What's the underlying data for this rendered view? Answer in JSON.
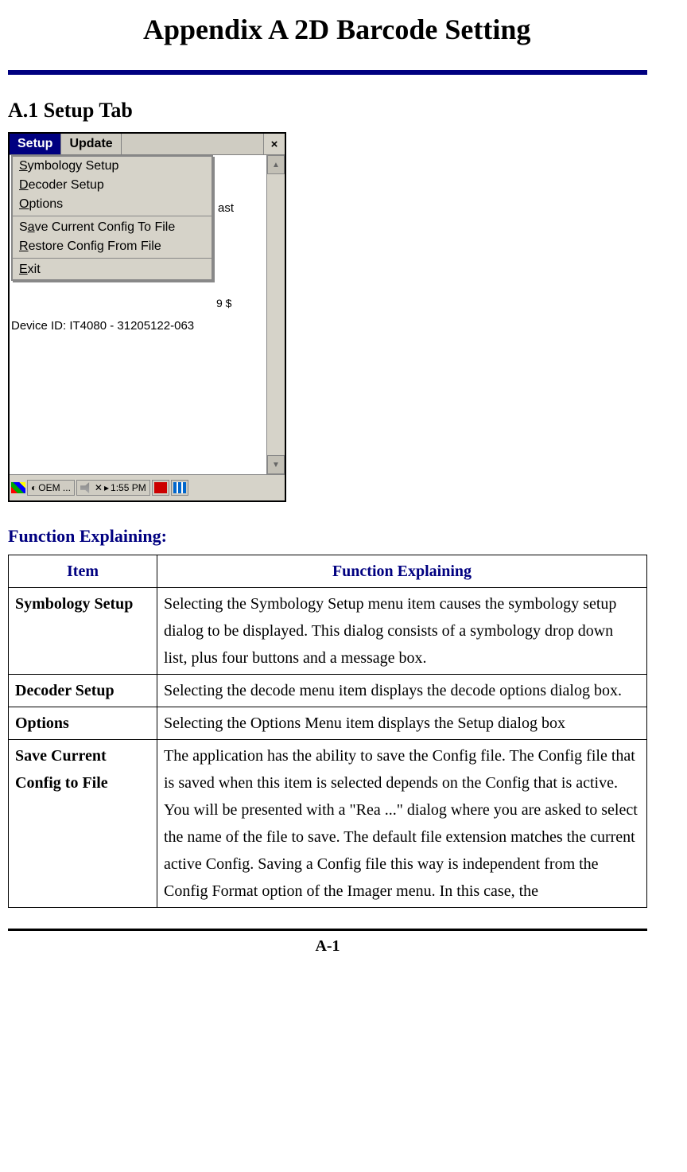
{
  "title": "Appendix A  2D Barcode Setting",
  "section": "A.1 Setup Tab",
  "screenshot": {
    "tabs": {
      "setup": "Setup",
      "update": "Update"
    },
    "menu": {
      "symbology": "Symbology Setup",
      "decoder": "Decoder Setup",
      "options": "Options",
      "save": "Save Current Config To File",
      "restore": "Restore Config From File",
      "exit": "Exit"
    },
    "peek_text": "ast",
    "peek_text2": "9 $",
    "device_id": "Device ID: IT4080 - 31205122-063",
    "taskbar": {
      "oem": "OEM ...",
      "time": "1:55 PM"
    }
  },
  "fn_heading": "Function Explaining:",
  "table": {
    "headers": {
      "item": "Item",
      "fn": "Function Explaining"
    },
    "rows": [
      {
        "item": "Symbology Setup",
        "desc": "Selecting the Symbology Setup menu item causes the symbology setup dialog to be displayed. This dialog consists of a symbology drop down list, plus four buttons and a message box."
      },
      {
        "item": "Decoder Setup",
        "desc": "Selecting the decode menu item displays the decode options dialog box."
      },
      {
        "item": "Options",
        "desc": "Selecting the Options Menu item displays the Setup dialog box"
      },
      {
        "item": "Save Current Config to File",
        "desc": "The application has the ability to save the Config file. The Config file that is saved when this item is selected depends on the Config that is active. You will be presented with a \"Rea ...\" dialog where you are asked to select the name of the file to save. The default file extension matches the current active Config. Saving a Config file this way is independent from the Config Format option of the Imager menu. In this case, the"
      }
    ]
  },
  "page_number": "A-1"
}
